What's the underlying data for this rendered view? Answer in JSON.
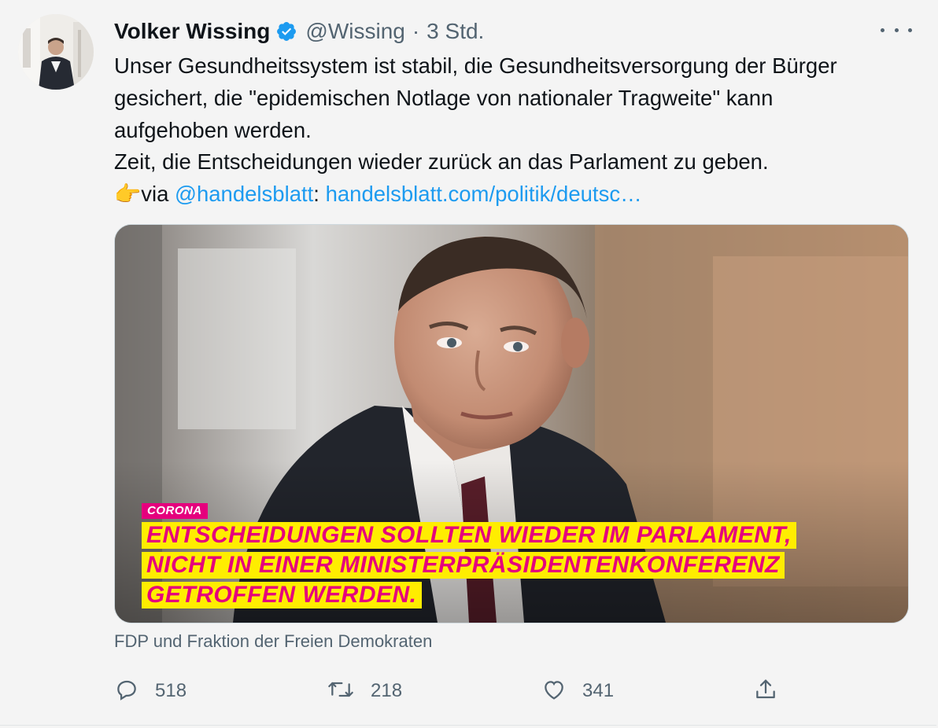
{
  "tweet": {
    "author_name": "Volker Wissing",
    "handle": "@Wissing",
    "separator": "·",
    "time": "3 Std.",
    "text_lines": [
      "Unser Gesundheitssystem ist stabil, die Gesundheitsversorgung der Bürger",
      "gesichert, die  \"epidemischen Notlage von nationaler Tragweite\" kann",
      "aufgehoben werden.",
      "Zeit, die Entscheidungen wieder zurück an das Parlament zu geben."
    ],
    "via_emoji": "👉",
    "via_text": "via ",
    "mention": "@handelsblatt",
    "colon": ": ",
    "url": "handelsblatt.com/politik/deutsc…"
  },
  "media": {
    "tag": "CORONA",
    "headline_lines": [
      "ENTSCHEIDUNGEN SOLLTEN WIEDER IM PARLAMENT,",
      "NICHT IN EINER MINISTERPRÄSIDENTENKONFERENZ",
      "GETROFFEN WERDEN."
    ],
    "source": "FDP und Fraktion der Freien Demokraten"
  },
  "actions": {
    "replies": "518",
    "retweets": "218",
    "likes": "341"
  },
  "icons": {
    "verified": "verified-badge-icon",
    "more": "more-options-icon",
    "reply": "reply-icon",
    "retweet": "retweet-icon",
    "like": "heart-icon",
    "share": "share-icon"
  },
  "colors": {
    "link": "#1d9bf0",
    "secondary_text": "#536471",
    "fdp_magenta": "#e5007d",
    "fdp_yellow": "#ffed00"
  }
}
